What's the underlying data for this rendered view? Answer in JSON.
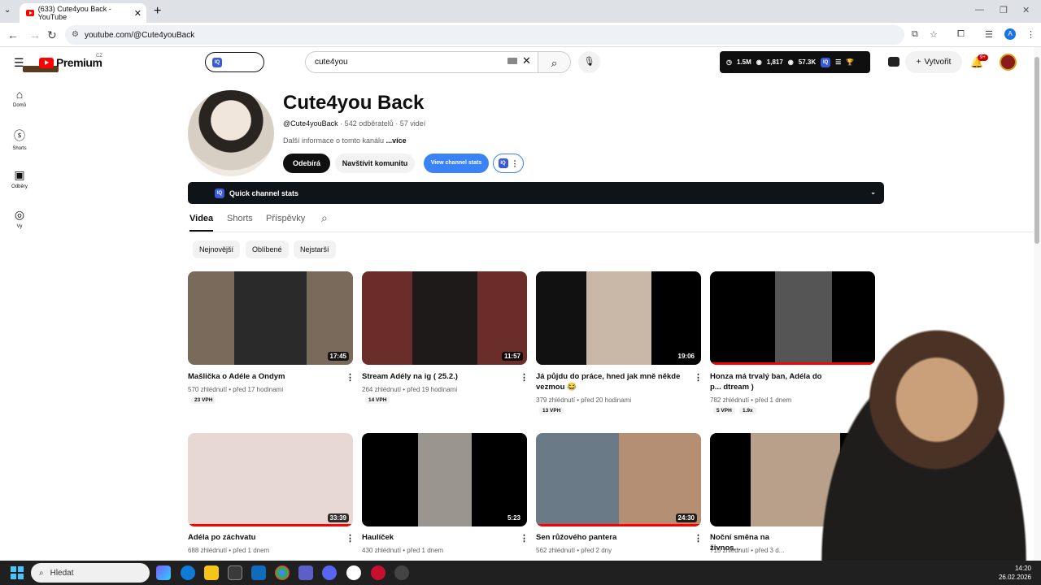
{
  "browser": {
    "tab_title": "(633) Cute4you Back - YouTube",
    "url": "youtube.com/@Cute4youBack",
    "tab_list_icon": "chevron-down-icon",
    "close_tab": "✕",
    "new_tab": "+"
  },
  "header": {
    "logo_text": "Premium",
    "logo_region": "CZ",
    "search_value": "cute4you",
    "stats": {
      "views": "1.5M",
      "subs": "1,817",
      "avg": "57.3K"
    },
    "create_label": "Vytvořit",
    "notifications_badge": "9+"
  },
  "sidebar": {
    "items": [
      {
        "label": "Domů",
        "icon": "home-icon"
      },
      {
        "label": "Shorts",
        "icon": "shorts-icon"
      },
      {
        "label": "Odběry",
        "icon": "subscriptions-icon"
      },
      {
        "label": "Vy",
        "icon": "account-icon"
      }
    ]
  },
  "channel": {
    "name": "Cute4you Back",
    "handle": "@Cute4youBack",
    "subscribers": "· 542 odběratelů · 57 videí",
    "description": "Další informace o tomto kanálu",
    "more": "...více",
    "subscribe_label": "Odebírá",
    "community_label": "Navštívit komunitu",
    "stats_label": "View channel stats",
    "quick_stats_label": "Quick channel stats"
  },
  "tabs": [
    "Videa",
    "Shorts",
    "Příspěvky"
  ],
  "chips": [
    "Nejnovější",
    "Oblíbené",
    "Nejstarší"
  ],
  "videos": [
    {
      "title": "Mašlička o Adéle a Ondym",
      "views": "570 zhlédnutí",
      "age": "před 17 hodinami",
      "duration": "17:45",
      "vph": "23 VPH"
    },
    {
      "title": "Stream Adély na ig ( 25.2.)",
      "views": "264 zhlédnutí",
      "age": "před 19 hodinami",
      "duration": "11:57",
      "vph": "14 VPH"
    },
    {
      "title": "Já půjdu do práce, hned jak mně někde vezmou 😂",
      "views": "379 zhlédnutí",
      "age": "před 20 hodinami",
      "duration": "19:06",
      "vph": "13 VPH"
    },
    {
      "title": "Honza má trvalý ban, Adéla do p... dtream )",
      "views": "782 zhlédnutí",
      "age": "před 1 dnem",
      "duration": "",
      "vph": "5 VPH",
      "ratio": "1.9x"
    },
    {
      "title": "Adéla po záchvatu",
      "views": "688 zhlédnutí",
      "age": "před 1 dnem",
      "duration": "33:39"
    },
    {
      "title": "Haulíček",
      "views": "430 zhlédnutí",
      "age": "před 1 dnem",
      "duration": "5:23"
    },
    {
      "title": "Sen růžového pantera",
      "views": "562 zhlédnutí",
      "age": "před 2 dny",
      "duration": "24:30"
    },
    {
      "title": "Noční směna na živnos...",
      "views": "715 zhlédnutí",
      "age": "před 3 d...",
      "duration": ""
    }
  ],
  "taskbar": {
    "search_placeholder": "Hledat",
    "time": "14:20",
    "date": "26.02.2026"
  }
}
